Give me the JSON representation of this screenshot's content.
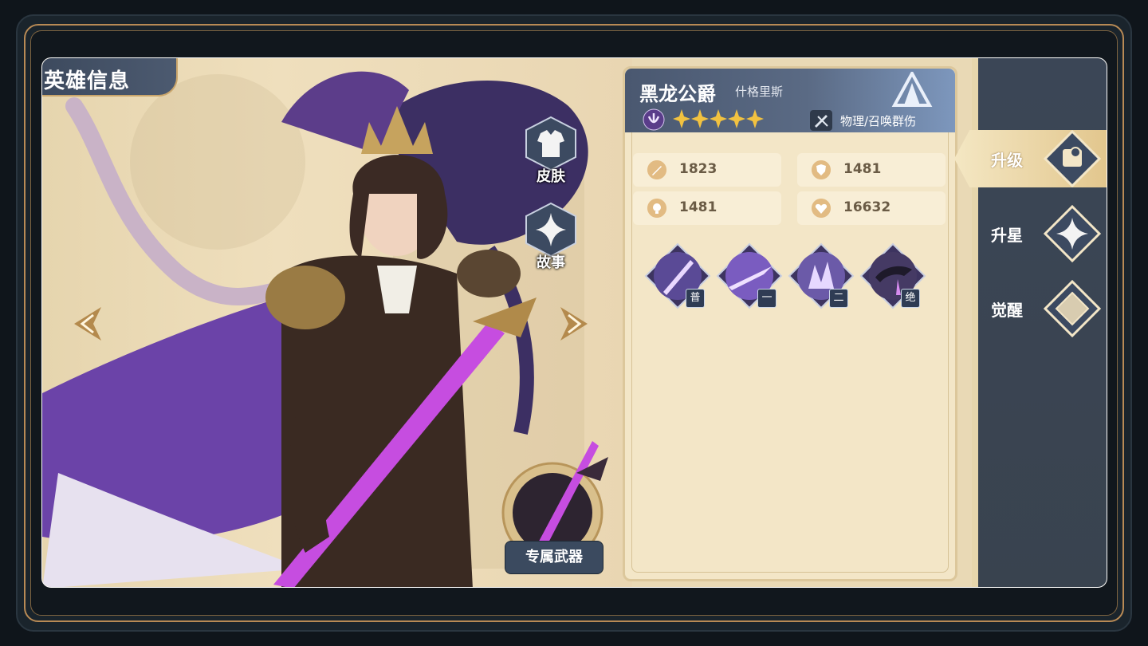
{
  "page": {
    "title": "英雄信息"
  },
  "hero": {
    "name": "黑龙公爵",
    "subtitle": "什格里斯",
    "stars": 5,
    "damage_type": "物理/召唤群伤"
  },
  "stats": [
    {
      "icon": "sword-icon",
      "value": "1823"
    },
    {
      "icon": "shield-icon",
      "value": "1481"
    },
    {
      "icon": "orb-icon",
      "value": "1481"
    },
    {
      "icon": "heart-icon",
      "value": "16632"
    }
  ],
  "skills": [
    {
      "tag": "普",
      "icon": "spear-skill-icon"
    },
    {
      "tag": "一",
      "icon": "slash-skill-icon"
    },
    {
      "tag": "二",
      "icon": "crystal-skill-icon"
    },
    {
      "tag": "绝",
      "icon": "dragon-skill-icon"
    }
  ],
  "side_buttons": {
    "skin": "皮肤",
    "story": "故事",
    "exclusive_weapon": "专属武器"
  },
  "right_menu": [
    {
      "label": "升级",
      "icon": "upgrade-book-icon",
      "active": true
    },
    {
      "label": "升星",
      "icon": "sparkle-star-icon",
      "active": false
    },
    {
      "label": "觉醒",
      "icon": "awaken-diamond-icon",
      "active": false
    }
  ],
  "colors": {
    "panel_bg": "#f3e6c7",
    "header_blue": "#4a5870",
    "menu_bg": "#3b4656",
    "gold": "#e2bb83",
    "purple": "#7b4fb8"
  }
}
